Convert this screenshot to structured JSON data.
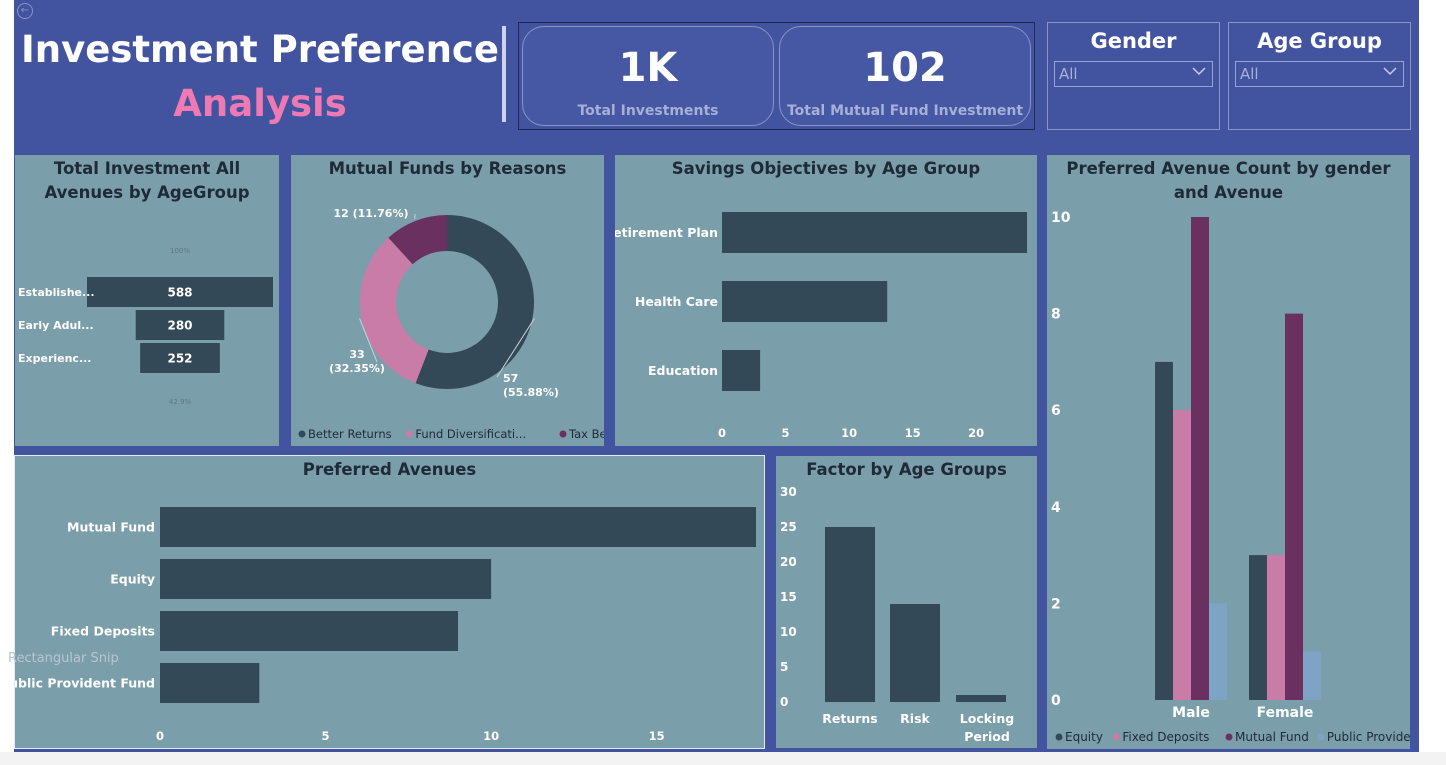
{
  "header": {
    "title_line1": "Investment Preference",
    "title_line2": "Analysis",
    "accent_color": "#ee7ab4",
    "background_color": "#4254a0"
  },
  "kpis": [
    {
      "value": "1K",
      "label": "Total Investments"
    },
    {
      "value": "102",
      "label": "Total Mutual Fund Investment"
    }
  ],
  "slicers": {
    "gender": {
      "title": "Gender",
      "value": "All"
    },
    "age_group": {
      "title": "Age Group",
      "value": "All"
    }
  },
  "overlay": {
    "snip_label": "Rectangular Snip"
  },
  "chart_data": [
    {
      "id": "funnel",
      "type": "funnel",
      "title": "Total Investment All Avenues by AgeGroup",
      "categories": [
        "Establishe...",
        "Early Adul...",
        "Experienc..."
      ],
      "values": [
        588,
        280,
        252
      ],
      "top_label": "100%",
      "bottom_label": "42.9%",
      "color": "#344957"
    },
    {
      "id": "donut",
      "type": "pie",
      "title": "Mutual Funds by Reasons",
      "slices": [
        {
          "name": "Better Returns",
          "value": 57,
          "label": "57 (55.88%)",
          "color": "#344957"
        },
        {
          "name": "Fund Diversificati...",
          "value": 33,
          "label": "33 (32.35%)",
          "color": "#c97ca8"
        },
        {
          "name": "Tax Bene...",
          "value": 12,
          "label": "12 (11.76%)",
          "color": "#6a3060"
        }
      ]
    },
    {
      "id": "savings",
      "type": "bar",
      "orientation": "horizontal",
      "title": "Savings Objectives by Age Group",
      "categories": [
        "Retirement Plan",
        "Health Care",
        "Education"
      ],
      "values": [
        24,
        13,
        3
      ],
      "xlim": [
        0,
        24
      ],
      "ticks": [
        0,
        5,
        10,
        15,
        20
      ],
      "color": "#344957"
    },
    {
      "id": "gender_avenue",
      "type": "bar",
      "title": "Preferred Avenue Count by gender and Avenue",
      "categories": [
        "Male",
        "Female"
      ],
      "series": [
        {
          "name": "Equity",
          "values": [
            7,
            3
          ],
          "color": "#344957"
        },
        {
          "name": "Fixed Deposits",
          "values": [
            6,
            3
          ],
          "color": "#c97ca8"
        },
        {
          "name": "Mutual Fund",
          "values": [
            10,
            8
          ],
          "color": "#6a3060"
        },
        {
          "name": "Public Provide...",
          "values": [
            2,
            1
          ],
          "color": "#7fa3c5"
        }
      ],
      "ylim": [
        0,
        10
      ],
      "ticks": [
        0,
        2,
        4,
        6,
        8,
        10
      ]
    },
    {
      "id": "avenues",
      "type": "bar",
      "orientation": "horizontal",
      "title": "Preferred Avenues",
      "categories": [
        "Mutual Fund",
        "Equity",
        "Fixed Deposits",
        "Public Provident Fund"
      ],
      "values": [
        18,
        10,
        9,
        3
      ],
      "xlim": [
        0,
        18
      ],
      "ticks": [
        0,
        5,
        10,
        15
      ],
      "color": "#344957"
    },
    {
      "id": "factor",
      "type": "bar",
      "title": "Factor by Age Groups",
      "categories": [
        "Returns",
        "Risk",
        "Locking Period"
      ],
      "values": [
        25,
        14,
        1
      ],
      "ylim": [
        0,
        30
      ],
      "ticks": [
        0,
        5,
        10,
        15,
        20,
        25,
        30
      ],
      "color": "#344957"
    }
  ]
}
